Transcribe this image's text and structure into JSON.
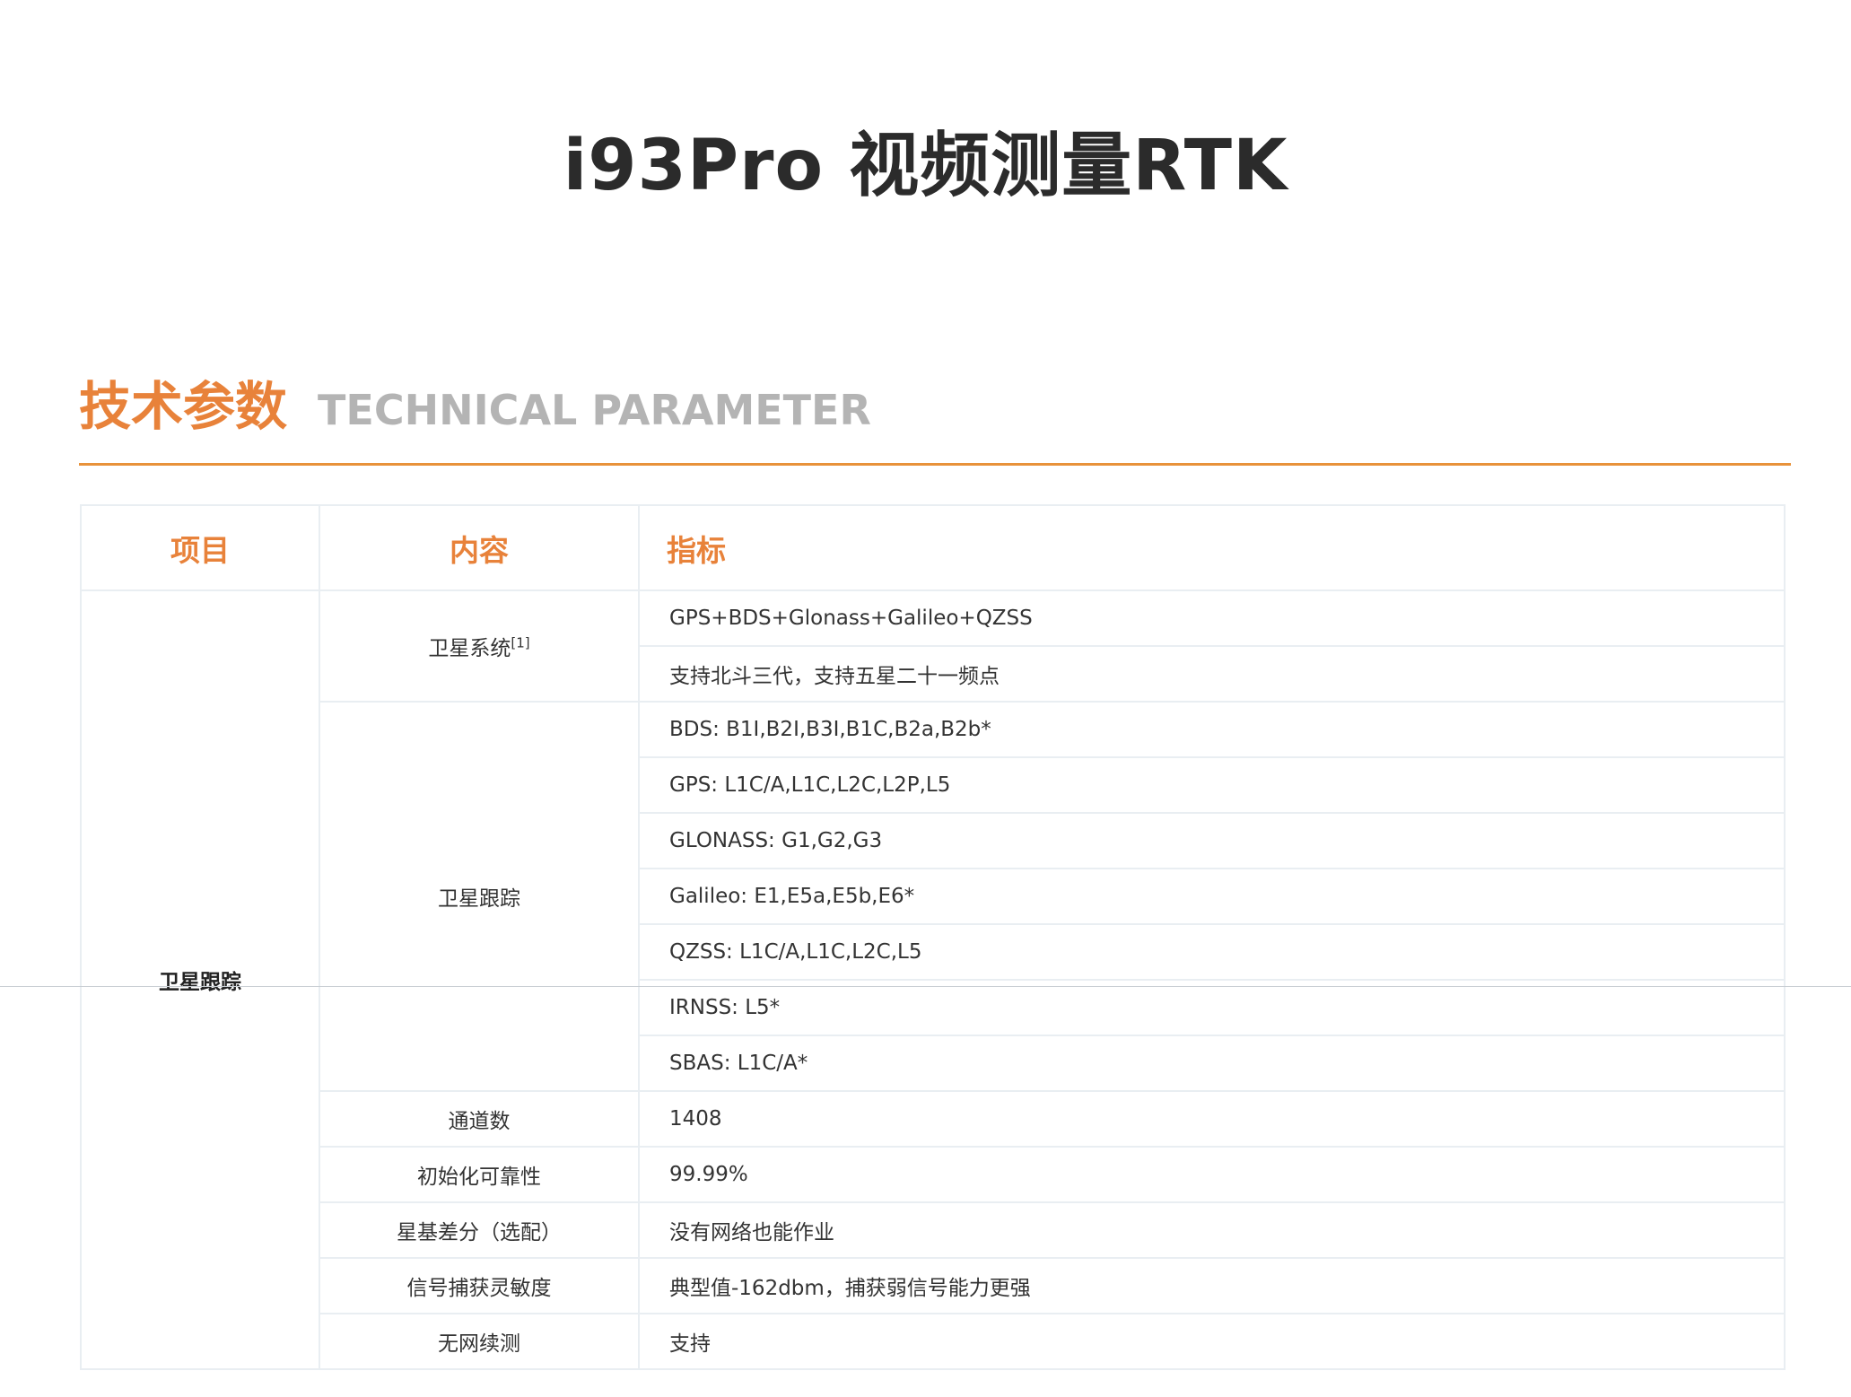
{
  "page_title": "i93Pro 视频测量RTK",
  "section": {
    "title_cn": "技术参数",
    "title_en": "TECHNICAL PARAMETER"
  },
  "table": {
    "headers": {
      "item": "项目",
      "content": "内容",
      "index": "指标"
    },
    "category": "卫星跟踪",
    "groups": [
      {
        "content": "卫星系统",
        "footnote": "[1]",
        "values": [
          "GPS+BDS+Glonass+Galileo+QZSS",
          "支持北斗三代，支持五星二十一频点"
        ]
      },
      {
        "content": "卫星跟踪",
        "values": [
          "BDS: B1I,B2I,B3I,B1C,B2a,B2b*",
          "GPS: L1C/A,L1C,L2C,L2P,L5",
          "GLONASS: G1,G2,G3",
          "Galileo: E1,E5a,E5b,E6*",
          "QZSS: L1C/A,L1C,L2C,L5",
          "IRNSS: L5*",
          "SBAS: L1C/A*"
        ]
      },
      {
        "content": "通道数",
        "values": [
          "1408"
        ]
      },
      {
        "content": "初始化可靠性",
        "values": [
          "99.99%"
        ]
      },
      {
        "content": "星基差分（选配）",
        "values": [
          "没有网络也能作业"
        ]
      },
      {
        "content": "信号捕获灵敏度",
        "values": [
          "典型值-162dbm，捕获弱信号能力更强"
        ]
      },
      {
        "content": "无网续测",
        "values": [
          "支持"
        ]
      }
    ]
  }
}
